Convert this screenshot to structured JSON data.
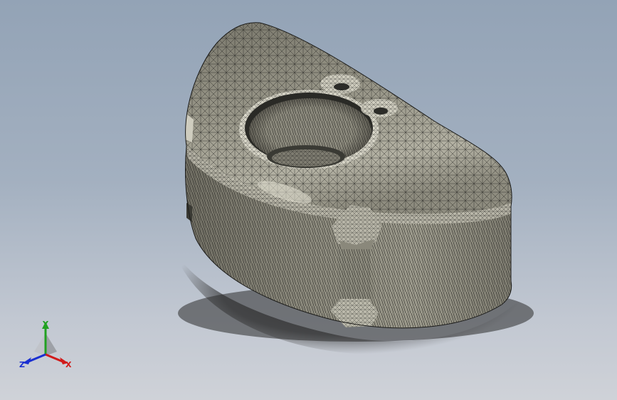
{
  "viewport": {
    "background_top": "#93a3b6",
    "background_bottom": "#cfd2d8"
  },
  "model": {
    "display_mode": "shaded-with-edges",
    "body_color": "#8c8a7d",
    "edge_color": "#1f1f1f",
    "features": [
      "central-bore",
      "countersunk-hole",
      "countersunk-hole",
      "side-boss",
      "side-boss"
    ]
  },
  "triad": {
    "x_label": "X",
    "y_label": "Y",
    "z_label": "Z",
    "x_color": "#d11a1a",
    "y_color": "#21a121",
    "z_color": "#1a2fd1"
  }
}
